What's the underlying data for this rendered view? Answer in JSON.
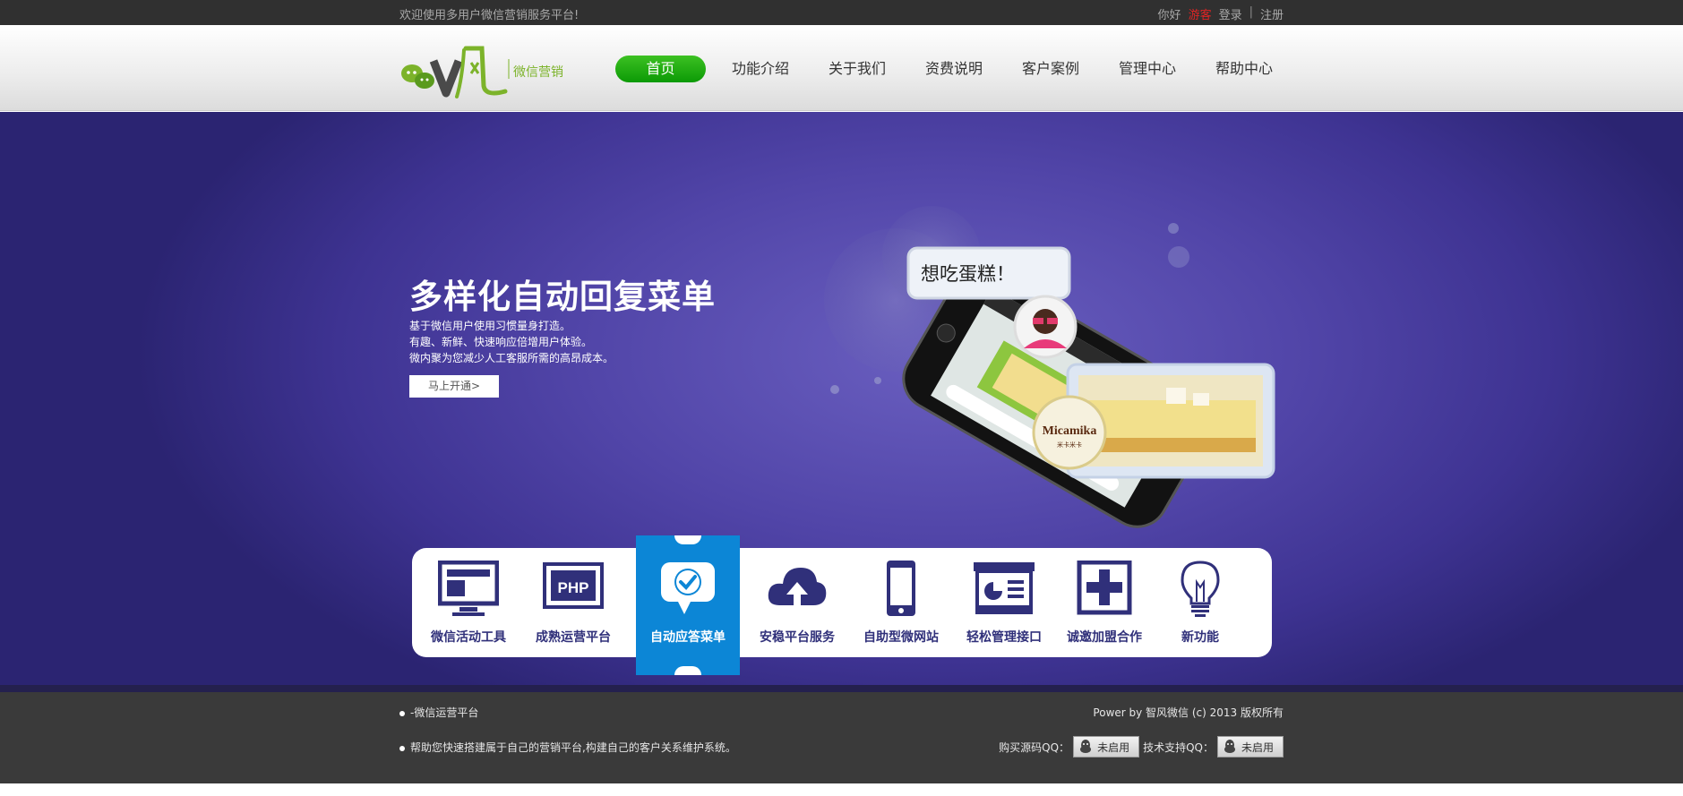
{
  "topbar": {
    "welcome": "欢迎使用多用户微信营销服务平台!",
    "hello": "你好",
    "guest": "游客",
    "login": "登录",
    "separator": "|",
    "register": "注册"
  },
  "header": {
    "logo_text": "微信营销",
    "logo_icon": "wechat-bubbles-icon",
    "nav": [
      "首页",
      "功能介绍",
      "关于我们",
      "资费说明",
      "客户案例",
      "管理中心",
      "帮助中心"
    ],
    "active_nav_color": "#13a00b"
  },
  "banner": {
    "title": "多样化自动回复菜单",
    "desc": [
      "基于微信用户使用习惯量身打造。",
      "有趣、新鲜、快速响应倍增用户体验。",
      "微内聚为您减少人工客服所需的高昂成本。"
    ],
    "cta": "马上开通>",
    "chat_bubble": "想吃蛋糕！",
    "brand_badge": "Micamika",
    "brand_sub": "米卡米卡",
    "background_color": "#5145a8"
  },
  "features": [
    {
      "label": "微信活动工具",
      "icon": "monitor-icon"
    },
    {
      "label": "成熟运营平台",
      "icon": "php-icon",
      "icon_text": "PHP"
    },
    {
      "label": "自动应答菜单",
      "icon": "chat-check-icon",
      "active": true
    },
    {
      "label": "安稳平台服务",
      "icon": "cloud-upload-icon"
    },
    {
      "label": "自助型微网站",
      "icon": "mobile-phone-icon"
    },
    {
      "label": "轻松管理接口",
      "icon": "dashboard-icon"
    },
    {
      "label": "诚邀加盟合作",
      "icon": "plus-icon"
    },
    {
      "label": "新功能",
      "icon": "lightbulb-icon"
    }
  ],
  "footer": {
    "left1": "-微信运营平台",
    "left2": "帮助您快速搭建属于自己的营销平台,构建自己的客户关系维护系统。",
    "power": "Power by 智风微信 (c) 2013 版权所有",
    "buy_qq_label": "购买源码QQ：",
    "tech_qq_label": "技术支持QQ：",
    "qq_status": "未启用"
  },
  "colors": {
    "accent_blue": "#0c86d6",
    "icon_navy": "#30307a",
    "brand_green": "#7cb32a"
  }
}
